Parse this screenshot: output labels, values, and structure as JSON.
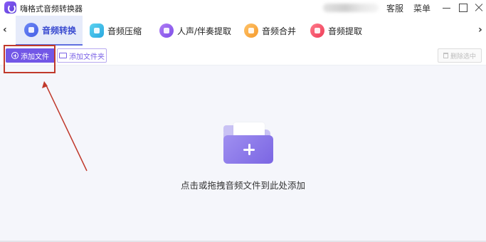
{
  "window": {
    "title": "嗨格式音频转换器",
    "service_label": "客服",
    "menu_label": "菜单"
  },
  "nav": {
    "left_arrow": "‹",
    "right_arrow": "›"
  },
  "tabs": [
    {
      "label": "音频转换",
      "icon": "headphones-icon",
      "active": true
    },
    {
      "label": "音频压缩",
      "icon": "compress-icon",
      "active": false
    },
    {
      "label": "人声/伴奏提取",
      "icon": "music-note-icon",
      "active": false
    },
    {
      "label": "音频合并",
      "icon": "merge-icon",
      "active": false
    },
    {
      "label": "音频提取",
      "icon": "microphone-icon",
      "active": false
    }
  ],
  "toolbar": {
    "add_file_label": "添加文件",
    "add_folder_label": "添加文件夹",
    "delete_selected_label": "删除选中"
  },
  "main": {
    "drop_hint": "点击或拖拽音频文件到此处添加"
  },
  "colors": {
    "accent": "#7257e6",
    "active_tab_bg": "#e6ebfa",
    "annotation": "#c0392b"
  }
}
